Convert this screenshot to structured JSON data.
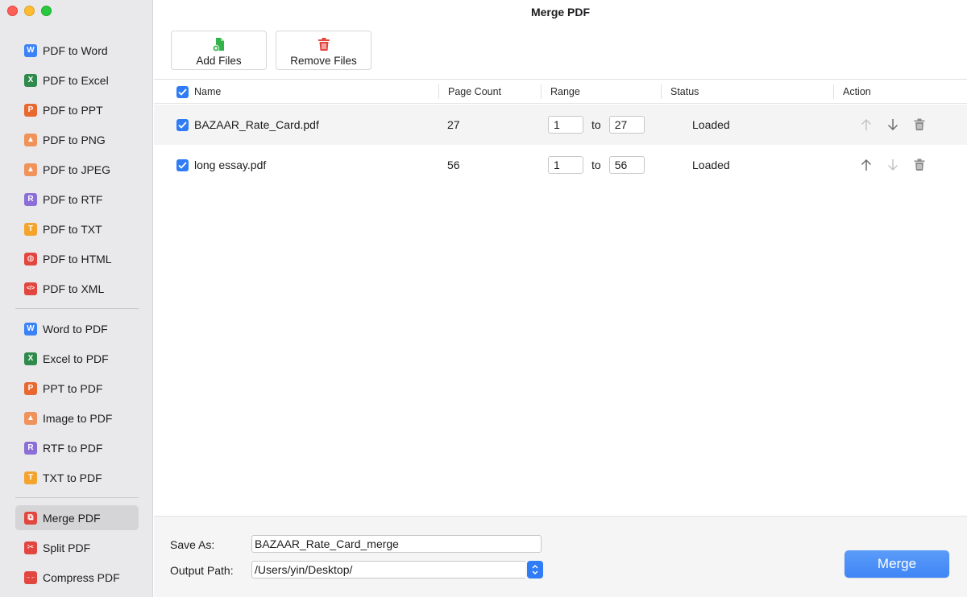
{
  "window": {
    "title": "Merge PDF"
  },
  "sidebar": {
    "groups": [
      [
        {
          "label": "PDF to Word",
          "icon": "word-icon",
          "glyph": "W",
          "color": "#3b82f6"
        },
        {
          "label": "PDF to Excel",
          "icon": "excel-icon",
          "glyph": "X",
          "color": "#2f8a4c"
        },
        {
          "label": "PDF to PPT",
          "icon": "ppt-icon",
          "glyph": "P",
          "color": "#e8682f"
        },
        {
          "label": "PDF to PNG",
          "icon": "image-icon",
          "glyph": "▲",
          "color": "#f0935a"
        },
        {
          "label": "PDF to JPEG",
          "icon": "image-icon",
          "glyph": "▲",
          "color": "#f0935a"
        },
        {
          "label": "PDF to RTF",
          "icon": "rtf-icon",
          "glyph": "R",
          "color": "#8b6fd6"
        },
        {
          "label": "PDF to TXT",
          "icon": "txt-icon",
          "glyph": "T",
          "color": "#f4a42c"
        },
        {
          "label": "PDF to HTML",
          "icon": "globe-icon",
          "glyph": "◍",
          "color": "#e2473f"
        },
        {
          "label": "PDF to XML",
          "icon": "code-icon",
          "glyph": "</>",
          "color": "#e2473f"
        }
      ],
      [
        {
          "label": "Word to PDF",
          "icon": "word-icon",
          "glyph": "W",
          "color": "#3b82f6"
        },
        {
          "label": "Excel to PDF",
          "icon": "excel-icon",
          "glyph": "X",
          "color": "#2f8a4c"
        },
        {
          "label": "PPT to PDF",
          "icon": "ppt-icon",
          "glyph": "P",
          "color": "#e8682f"
        },
        {
          "label": "Image to PDF",
          "icon": "image-icon",
          "glyph": "▲",
          "color": "#f0935a"
        },
        {
          "label": "RTF to PDF",
          "icon": "rtf-icon",
          "glyph": "R",
          "color": "#8b6fd6"
        },
        {
          "label": "TXT to PDF",
          "icon": "txt-icon",
          "glyph": "T",
          "color": "#f4a42c"
        }
      ],
      [
        {
          "label": "Merge PDF",
          "icon": "merge-icon",
          "glyph": "⧉",
          "color": "#e2473f",
          "active": true
        },
        {
          "label": "Split PDF",
          "icon": "scissors-icon",
          "glyph": "✂",
          "color": "#e2473f"
        },
        {
          "label": "Compress PDF",
          "icon": "compress-icon",
          "glyph": "→←",
          "color": "#e2473f"
        }
      ]
    ]
  },
  "toolbar": {
    "add_files": "Add Files",
    "remove_files": "Remove Files",
    "add_color": "#34b34a",
    "remove_color": "#e2473f"
  },
  "table": {
    "headers": {
      "name": "Name",
      "page_count": "Page Count",
      "range": "Range",
      "status": "Status",
      "action": "Action"
    },
    "range_separator": "to",
    "rows": [
      {
        "name": "BAZAAR_Rate_Card.pdf",
        "page_count": "27",
        "range_from": "1",
        "range_to": "27",
        "status": "Loaded",
        "checked": true,
        "up_enabled": false,
        "down_enabled": true
      },
      {
        "name": "long essay.pdf",
        "page_count": "56",
        "range_from": "1",
        "range_to": "56",
        "status": "Loaded",
        "checked": true,
        "up_enabled": true,
        "down_enabled": false
      }
    ]
  },
  "bottom": {
    "save_as_label": "Save As:",
    "save_as_value": "BAZAAR_Rate_Card_merge",
    "output_path_label": "Output Path:",
    "output_path_value": "/Users/yin/Desktop/",
    "merge_label": "Merge"
  },
  "colors": {
    "accent": "#2f7cf6"
  }
}
